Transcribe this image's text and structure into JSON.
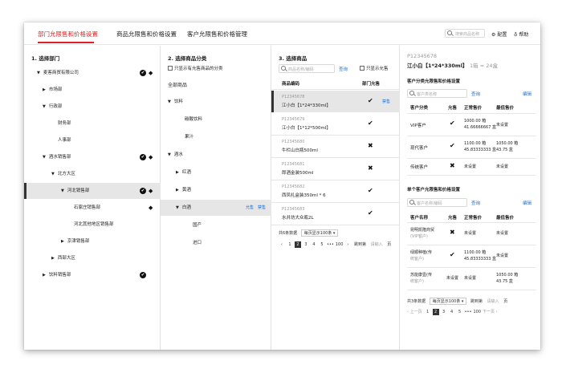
{
  "tabs": [
    {
      "label": "部门允限售和价格设置",
      "active": true
    },
    {
      "label": "商品允限售和价格设置",
      "active": false
    },
    {
      "label": "客户允限售和价格管理",
      "active": false
    }
  ],
  "topbar": {
    "search_placeholder": "搜索商品名称",
    "config_label": "配置",
    "help_label": "帮助"
  },
  "dept": {
    "title": "1. 选择部门",
    "items": [
      {
        "label": "麦客商贸有限公司"
      },
      {
        "label": "市场部"
      },
      {
        "label": "行政部"
      },
      {
        "label": "财务部"
      },
      {
        "label": "人事部"
      },
      {
        "label": "酒水销售部"
      },
      {
        "label": "北方大区"
      },
      {
        "label": "河北销售部"
      },
      {
        "label": "石家庄销售部"
      },
      {
        "label": "河北其他地区销售部"
      },
      {
        "label": "京津销售部"
      },
      {
        "label": "西部大区"
      },
      {
        "label": "饮料销售部"
      }
    ]
  },
  "cat": {
    "title": "2. 选择商品分类",
    "only_allowed": "只显示有允售商品的分类",
    "all": "全部商品",
    "items": [
      {
        "label": "饮料"
      },
      {
        "label": "碳酸饮料"
      },
      {
        "label": "果汁"
      },
      {
        "label": "酒水"
      },
      {
        "label": "红酒"
      },
      {
        "label": "黄酒"
      },
      {
        "label": "白酒",
        "allow": "允售",
        "forbid": "禁售"
      },
      {
        "label": "国产"
      },
      {
        "label": "进口"
      }
    ]
  },
  "prod": {
    "title": "3. 选择商品",
    "search_placeholder": "商品名称/编码",
    "search_btn": "查询",
    "only_allowed": "只显示允售",
    "col_code": "商品编码",
    "col_allow": "部门允售",
    "rows": [
      {
        "code": "P12345678",
        "name": "江小白【1*24*330ml】",
        "forbid": "禁售"
      },
      {
        "code": "P12345679",
        "name": "江小白【1*12*500ml】"
      },
      {
        "code": "P12345680",
        "name": "牛栏山白瓶500ml"
      },
      {
        "code": "P12345681",
        "name": "郎酒金装500ml"
      },
      {
        "code": "P12345682",
        "name": "西凤礼盒装350ml * 6"
      },
      {
        "code": "P12345683",
        "name": "水井坊大众瓶2L"
      }
    ],
    "pager": {
      "total": "共6条数据",
      "per_page": "每页显示100条",
      "pages": [
        "1",
        "2",
        "3",
        "4",
        "5",
        "•••",
        "100"
      ],
      "jump": "跳到第",
      "jump_placeholder": "请输入",
      "page_unit": "页"
    }
  },
  "detail": {
    "code": "P12345678",
    "name": "江小白【1*24*330ml】",
    "spec": "1箱 = 24盒",
    "cust_cat_title": "客户分类允限售和价格设置",
    "cust_cat_placeholder": "客户类名称",
    "search_btn": "查询",
    "edit_btn": "编辑",
    "cat_cols": [
      "客户分类",
      "允售",
      "正常售价",
      "最低售价"
    ],
    "cat_rows": [
      {
        "name": "VIP客户",
        "allow": "check",
        "price": "1000.00 箱\n41.66666667 盒",
        "min": "未设置"
      },
      {
        "name": "现代客户",
        "allow": "check",
        "price": "1100.00 箱\n45.83333333 盒",
        "min": "1050.00 箱\n43.75 盒"
      },
      {
        "name": "传统客户",
        "allow": "cross",
        "price": "未设置",
        "min": "未设置"
      }
    ],
    "cust_title": "单个客户允限售和价格设置",
    "cust_placeholder": "客户名称/编码",
    "cust_cols": [
      "客户名称",
      "允售",
      "正常售价",
      "最低售价"
    ],
    "cust_rows": [
      {
        "name": "昆明凯隆商贸\n(VIP客户)",
        "allow": "cross",
        "price": "未设置",
        "min": "未设置"
      },
      {
        "name": "绿顺种植(传\n统客户)",
        "allow": "check",
        "price": "1100.00 箱\n45.83333333 盒",
        "min": "未设置"
      },
      {
        "name": "苏能康壹(传\n统客户)",
        "allow": "未设置",
        "price": "未设置",
        "min": "1050.00 箱\n43.75 盒"
      }
    ],
    "pager": {
      "total": "共3条数据",
      "per_page": "每页显示100条",
      "jump": "跳到第",
      "jump_placeholder": "请输入",
      "page_unit": "页",
      "prev": "上一页",
      "next": "下一页",
      "pages": [
        "1",
        "2",
        "3",
        "4",
        "5",
        "•••",
        "100"
      ]
    }
  }
}
